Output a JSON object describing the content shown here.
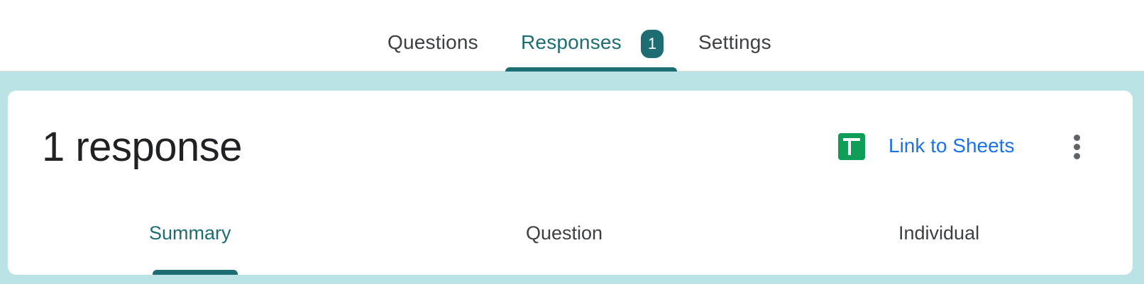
{
  "tabs": {
    "questions": "Questions",
    "responses": "Responses",
    "responses_badge": "1",
    "settings": "Settings",
    "active": "responses"
  },
  "card": {
    "title": "1 response",
    "link_sheets_label": "Link to Sheets",
    "sheets_icon": "google-sheets-icon",
    "more_icon": "more-vert-icon"
  },
  "subtabs": {
    "summary": "Summary",
    "question": "Question",
    "individual": "Individual",
    "active": "summary"
  },
  "colors": {
    "accent": "#1d6d73",
    "background": "#bbe3e6",
    "link": "#1a73e8",
    "sheets": "#0f9d58"
  }
}
